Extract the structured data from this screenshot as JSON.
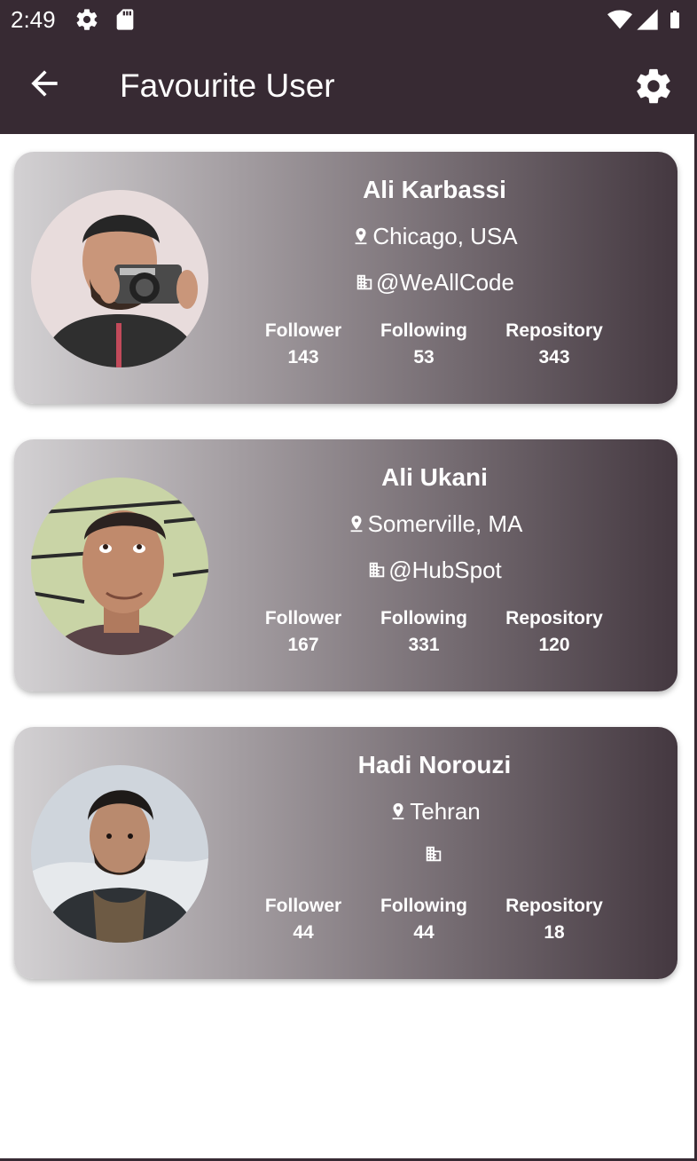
{
  "status_bar": {
    "time": "2:49",
    "icons": [
      "settings-gear-icon",
      "sd-card-icon",
      "wifi-icon",
      "signal-icon",
      "battery-icon"
    ]
  },
  "app_bar": {
    "title": "Favourite User",
    "back_icon": "arrow-back-icon",
    "settings_icon": "gear-icon"
  },
  "colors": {
    "app_bar": "#372a33",
    "card_gradient_start": "#d3d1d3",
    "card_gradient_end": "#443840",
    "text": "#ffffff"
  },
  "labels": {
    "follower": "Follower",
    "following": "Following",
    "repository": "Repository"
  },
  "users": [
    {
      "name": "Ali Karbassi",
      "location": "Chicago, USA",
      "company": "@WeAllCode",
      "follower": "143",
      "following": "53",
      "repository": "343",
      "avatar": "man-with-camera-photo"
    },
    {
      "name": "Ali Ukani",
      "location": "Somerville, MA",
      "company": "@HubSpot",
      "follower": "167",
      "following": "331",
      "repository": "120",
      "avatar": "man-looking-up-photo"
    },
    {
      "name": "Hadi Norouzi",
      "location": "Tehran",
      "company": "",
      "follower": "44",
      "following": "44",
      "repository": "18",
      "avatar": "man-in-winter-jacket-photo"
    }
  ]
}
